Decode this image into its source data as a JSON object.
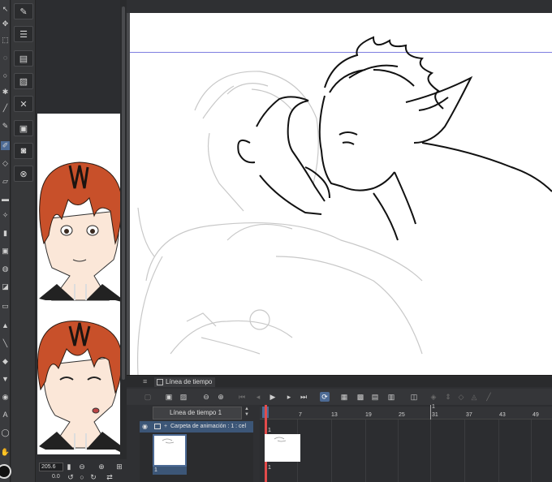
{
  "reference": {
    "zoom_value": "205.6",
    "rotation_value": "0.0"
  },
  "timeline": {
    "tab_label": "Línea de tiempo",
    "name": "Línea de tiempo 1",
    "folder_label": "Carpeta de animación : 1 : cel",
    "cel_number": "1",
    "frame_marker": "1",
    "end_marker": "1",
    "frame_numbers": [
      "1",
      "7",
      "13",
      "19",
      "25",
      "31",
      "37",
      "43",
      "49"
    ]
  },
  "colors": {
    "accent": "#4d6b95",
    "playhead": "#e34b4b",
    "hair_red": "#c8502a",
    "guide": "#7e7ee0"
  }
}
